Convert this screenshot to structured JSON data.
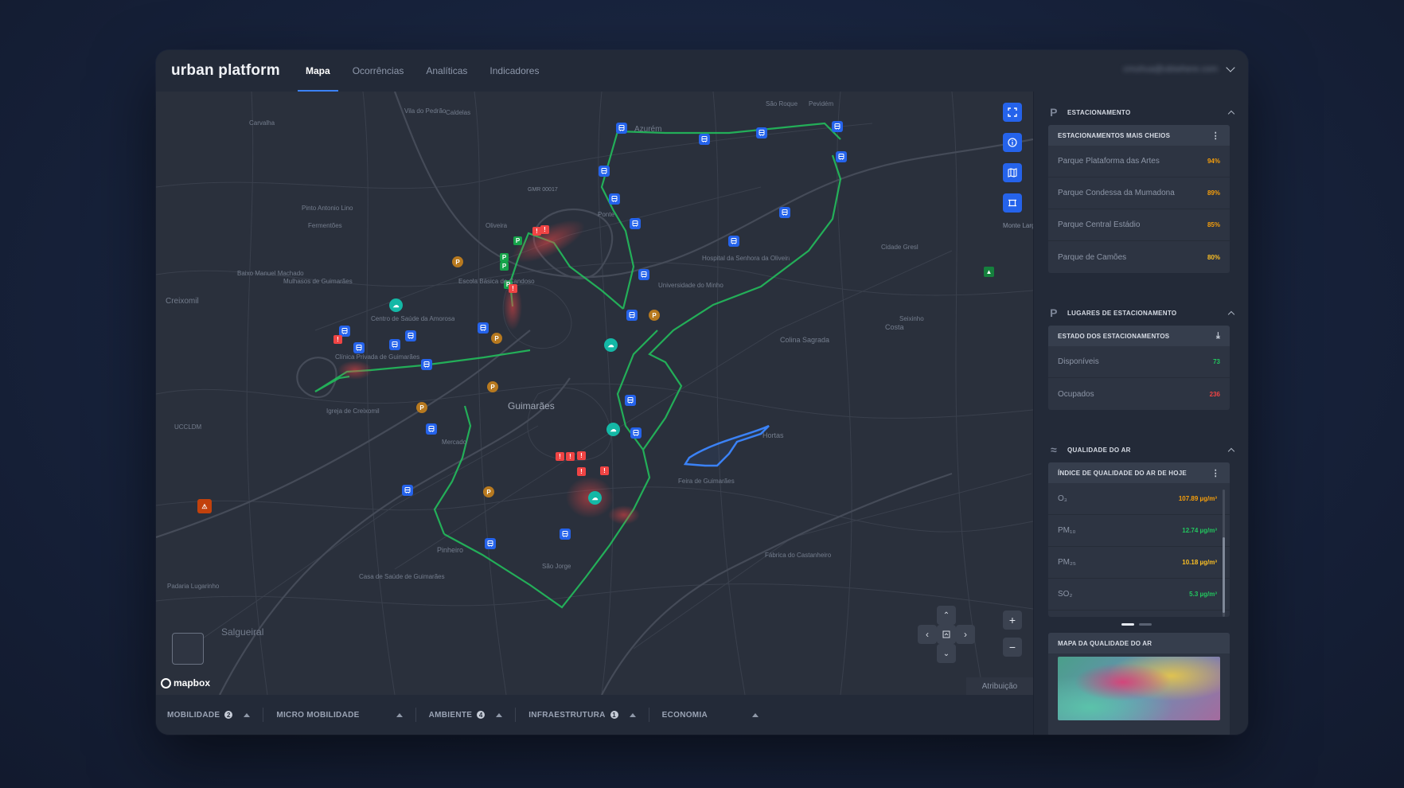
{
  "app": {
    "brand": "urban platform",
    "user_email": "cmuhua@ubiwhere.com"
  },
  "nav": {
    "tabs": [
      {
        "label": "Mapa",
        "active": true
      },
      {
        "label": "Ocorrências",
        "active": false
      },
      {
        "label": "Analíticas",
        "active": false
      },
      {
        "label": "Indicadores",
        "active": false
      }
    ]
  },
  "map": {
    "city_label": "Guimarães",
    "place_labels": [
      "Azurém",
      "Creixomil",
      "Salgueiral",
      "Hortas",
      "Colina Sagrada",
      "Costa",
      "Pinheiro",
      "Fermentões",
      "Ponte",
      "Monte Largo",
      "São Roque",
      "Pevidém",
      "Vila do Pedrão",
      "Caldelas",
      "Escola Básica de Candoso",
      "Centro de Saúde da Amorosa",
      "Clínica Privada de Guimarães",
      "Hospital da Senhora da Oliveira Guimarães",
      "Universidade do Minho",
      "UCCLDM",
      "Igreja de Creixomil",
      "Mercado",
      "Feira de Guimarães",
      "São Jorge",
      "Casa de Saúde de Guimarães",
      "Fábrica do Castanheiro",
      "Padaria Lugarinho",
      "Mulhasos de Guimarães",
      "Baixo Manuel Machado",
      "Pinto Antonio Lino",
      "Carvalha",
      "Cidade Gresl",
      "Seixinho",
      "Monte Largo",
      "Oliveira"
    ],
    "route_label": "GMR 00017",
    "attribution": "Atribuição",
    "mapbox": "mapbox",
    "icons": {
      "bus": "bus-stop-icon",
      "parking": "parking-icon",
      "air": "air-quality-icon",
      "incident": "incident-icon"
    }
  },
  "layers": [
    {
      "label": "MOBILIDADE",
      "count": "2"
    },
    {
      "label": "MICRO MOBILIDADE",
      "count": ""
    },
    {
      "label": "AMBIENTE",
      "count": "4"
    },
    {
      "label": "INFRAESTRUTURA",
      "count": "1"
    },
    {
      "label": "ECONOMIA",
      "count": ""
    }
  ],
  "sidebar": {
    "parking": {
      "title": "ESTACIONAMENTO",
      "card_title": "ESTACIONAMENTOS MAIS CHEIOS",
      "rows": [
        {
          "name": "Parque Plataforma das Artes",
          "value": "94%"
        },
        {
          "name": "Parque Condessa da Mumadona",
          "value": "89%"
        },
        {
          "name": "Parque Central Estádio",
          "value": "85%"
        },
        {
          "name": "Parque de Camões",
          "value": "80%"
        }
      ]
    },
    "spots": {
      "title": "LUGARES DE ESTACIONAMENTO",
      "card_title": "ESTADO DOS ESTACIONAMENTOS",
      "rows": [
        {
          "name": "Disponíveis",
          "value": "73"
        },
        {
          "name": "Ocupados",
          "value": "236"
        }
      ]
    },
    "air": {
      "title": "QUALIDADE DO AR",
      "card_title": "ÍNDICE DE QUALIDADE DO AR DE HOJE",
      "rows": [
        {
          "name": "O₃",
          "value": "107.89 µg/m³"
        },
        {
          "name": "PM₁₀",
          "value": "12.74 µg/m³"
        },
        {
          "name": "PM₂₅",
          "value": "10.18 µg/m³"
        },
        {
          "name": "SO₂",
          "value": "5.3 µg/m³"
        }
      ],
      "map_title": "MAPA DA QUALIDADE DO AR"
    }
  },
  "colors": {
    "accent": "#2563eb",
    "route": "#22c55e",
    "incident": "#ef4444",
    "parking_marker": "#b7791f",
    "air_marker": "#14b8a6"
  }
}
